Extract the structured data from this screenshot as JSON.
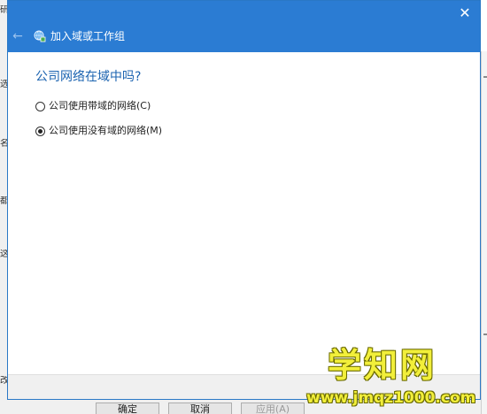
{
  "dialog": {
    "title": "加入域或工作组",
    "close_glyph": "✕",
    "back_glyph": "←",
    "question": "公司网络在域中吗?",
    "options": [
      {
        "label": "公司使用带域的网络(C)",
        "checked": false
      },
      {
        "label": "公司使用没有域的网络(M)",
        "checked": true
      }
    ]
  },
  "background": {
    "left_edge_chars": [
      "研",
      "选",
      "名",
      "都",
      "这",
      "改"
    ],
    "buttons": [
      "确定",
      "取消",
      "应用(A)"
    ]
  },
  "watermark": {
    "title": "学知网",
    "url": "www.jmqz1000.com"
  },
  "colors": {
    "titlebar": "#2b7cd3",
    "question": "#1b63b0",
    "watermark": "#f2ef3a"
  }
}
